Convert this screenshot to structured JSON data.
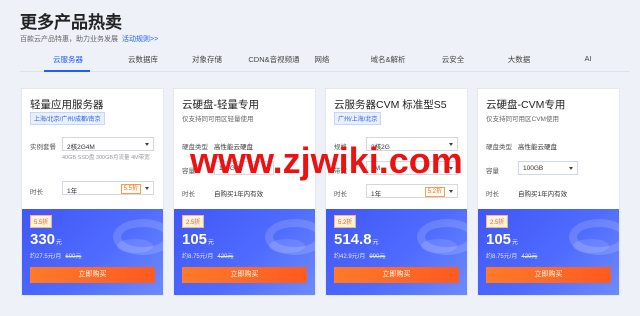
{
  "page": {
    "title": "更多产品热卖",
    "subtitle": "百款云产品特惠，助力业务发展",
    "subtitle_link": "活动规则>>"
  },
  "tabs": [
    {
      "label": "云服务器",
      "active": true
    },
    {
      "label": "云数据库",
      "active": false
    },
    {
      "label": "对象存储",
      "active": false
    },
    {
      "label": "CDN&音视频通",
      "active": false
    },
    {
      "label": "网络",
      "active": false
    },
    {
      "label": "域名&解析",
      "active": false
    },
    {
      "label": "云安全",
      "active": false
    },
    {
      "label": "大数据",
      "active": false
    },
    {
      "label": "AI",
      "active": false
    }
  ],
  "cards": [
    {
      "name": "轻量应用服务器",
      "tag": "上海/北京/广州/成都/南京",
      "spec_label": "实例套餐",
      "spec_value": "2核2G4M",
      "spec_note": "40GB SSD盘 300GB月流量 4M带宽",
      "duration_label": "时长",
      "duration_value": "1年",
      "duration_discount": "5.5折",
      "discount_badge": "5.5折",
      "price": "330",
      "price_unit": "元",
      "per_month": "约27.5元/月",
      "original_price": "600元",
      "buy_label": "立即购买"
    },
    {
      "name": "云硬盘-轻量专用",
      "desc": "仅支持同可用区轻量使用",
      "type_label": "硬盘类型",
      "type_value": "高性能云硬盘",
      "capacity_label": "容量",
      "capacity_value": "100GB",
      "duration_label": "时长",
      "duration_value": "自购买1年内有效",
      "discount_badge": "2.5折",
      "price": "105",
      "price_unit": "元",
      "per_month": "约8.75元/月",
      "original_price": "420元",
      "buy_label": "立即购买"
    },
    {
      "name": "云服务器CVM 标准型S5",
      "tag": "广州/上海/北京",
      "spec_label": "规格",
      "spec_value": "2核2G",
      "bandwidth_label": "带宽",
      "bandwidth_value": "1M",
      "disk_label": "系统盘",
      "disk_value": "50G",
      "duration_label": "时长",
      "duration_value": "1年",
      "duration_discount": "5.2折",
      "discount_badge": "5.2折",
      "price": "514.8",
      "price_unit": "元",
      "per_month": "约42.9元/月",
      "original_price": "990元",
      "buy_label": "立即购买"
    },
    {
      "name": "云硬盘-CVM专用",
      "desc": "仅支持同可用区CVM使用",
      "type_label": "硬盘类型",
      "type_value": "高性能云硬盘",
      "capacity_label": "容量",
      "capacity_value": "100GB",
      "duration_label": "时长",
      "duration_value": "自购买1年内有效",
      "discount_badge": "2.5折",
      "price": "105",
      "price_unit": "元",
      "per_month": "约8.75元/月",
      "original_price": "420元",
      "buy_label": "立即购买"
    }
  ],
  "watermark": "www.zjwiki.com",
  "colors": {
    "accent": "#1d5fff",
    "price_bg": "#4f6bff",
    "buy_button": "#ff6a2a",
    "watermark": "#ee1111"
  }
}
